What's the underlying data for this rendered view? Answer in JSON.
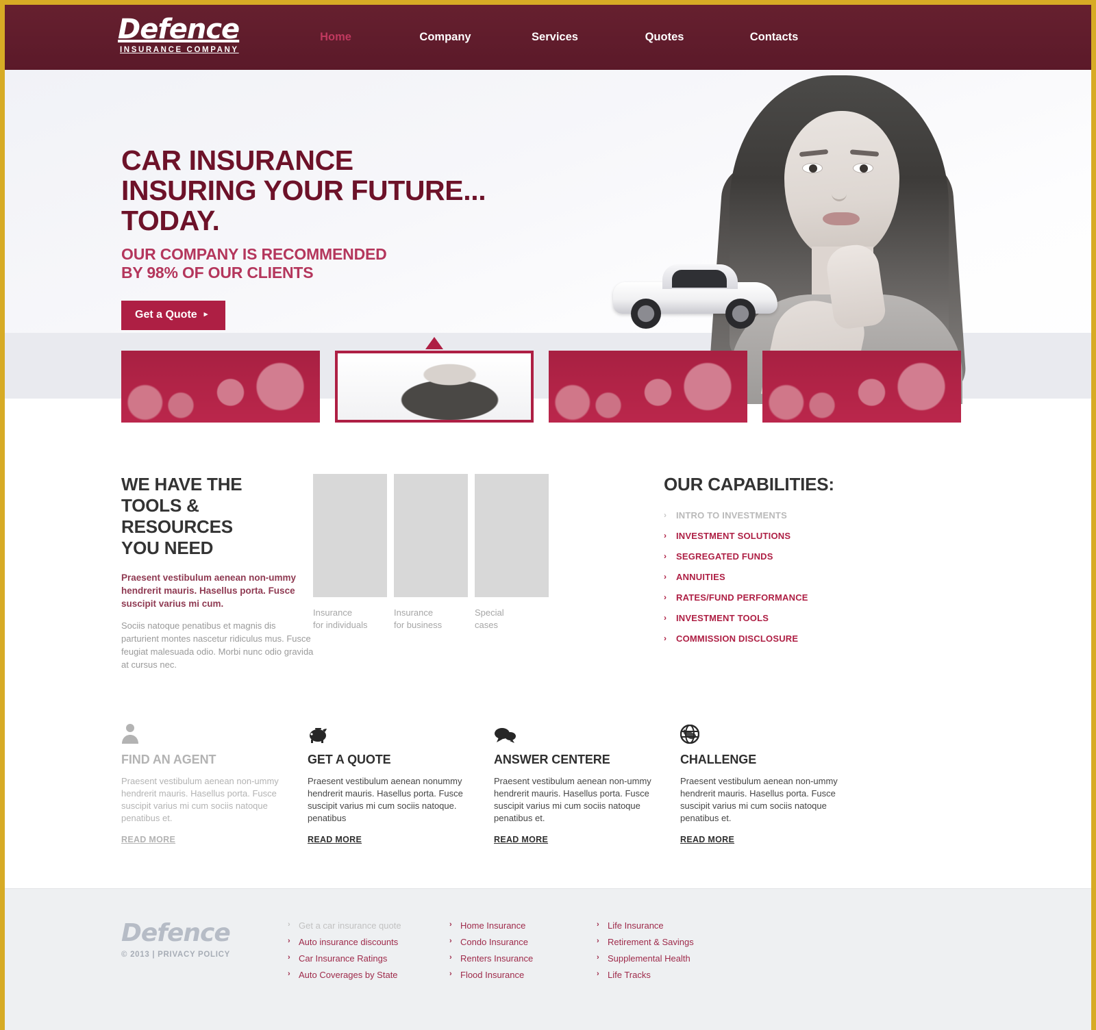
{
  "brand": {
    "name": "Defence",
    "tagline": "INSURANCE COMPANY"
  },
  "nav": {
    "items": [
      {
        "label": "Home",
        "active": true
      },
      {
        "label": "Company",
        "active": false
      },
      {
        "label": "Services",
        "active": false
      },
      {
        "label": "Quotes",
        "active": false
      },
      {
        "label": "Contacts",
        "active": false
      }
    ]
  },
  "hero": {
    "title_line1": "CAR INSURANCE",
    "title_line2": "INSURING YOUR FUTURE...",
    "title_line3": "TODAY.",
    "subtitle_line1": "OUR COMPANY IS RECOMMENDED",
    "subtitle_line2": "BY 98% OF OUR CLIENTS",
    "cta_label": "Get a Quote",
    "cta_arrow": "▸"
  },
  "slider": {
    "thumbs": [
      {
        "name": "thumb-1-family",
        "active": false
      },
      {
        "name": "thumb-2-woman-with-car",
        "active": true
      },
      {
        "name": "thumb-3-couple",
        "active": false
      },
      {
        "name": "thumb-4-business-group",
        "active": false
      }
    ]
  },
  "tools": {
    "title_line1": "WE HAVE THE",
    "title_line2": "TOOLS & RESOURCES",
    "title_line3": "YOU NEED",
    "lead": "Praesent vestibulum aenean non-ummy hendrerit mauris. Hasellus porta. Fusce suscipit varius mi cum.",
    "body": "Sociis natoque penatibus et magnis dis parturient montes nascetur ridiculus mus. Fusce feugiat malesuada odio. Morbi nunc odio gravida at cursus nec."
  },
  "mid_images": [
    {
      "caption_line1": "Insurance",
      "caption_line2": "for individuals",
      "name": "photo-insurance-for-individuals"
    },
    {
      "caption_line1": "Insurance",
      "caption_line2": "for business",
      "name": "photo-insurance-for-business"
    },
    {
      "caption_line1": "Special",
      "caption_line2": "cases",
      "name": "photo-special-cases"
    }
  ],
  "capabilities": {
    "title": "OUR CAPABILITIES:",
    "chevron": "›",
    "items": [
      {
        "label": "INTRO TO INVESTMENTS",
        "muted": true
      },
      {
        "label": "INVESTMENT SOLUTIONS",
        "muted": false
      },
      {
        "label": "SEGREGATED FUNDS",
        "muted": false
      },
      {
        "label": "ANNUITIES",
        "muted": false
      },
      {
        "label": "RATES/FUND PERFORMANCE",
        "muted": false
      },
      {
        "label": "INVESTMENT TOOLS",
        "muted": false
      },
      {
        "label": "COMMISSION DISCLOSURE",
        "muted": false
      }
    ]
  },
  "features": [
    {
      "icon": "person-icon",
      "title": "FIND AN AGENT",
      "text": "Praesent vestibulum aenean non-ummy hendrerit mauris. Hasellus porta. Fusce suscipit varius mi cum sociis natoque penatibus et.",
      "more": "READ MORE",
      "muted": true
    },
    {
      "icon": "piggy-bank-icon",
      "title": "GET A QUOTE",
      "text": "Praesent vestibulum aenean nonummy hendrerit mauris. Hasellus porta. Fusce suscipit varius mi cum sociis natoque. penatibus",
      "more": "READ MORE",
      "muted": false
    },
    {
      "icon": "speech-bubbles-icon",
      "title": "ANSWER CENTERE",
      "text": "Praesent vestibulum aenean non-ummy hendrerit mauris. Hasellus porta. Fusce suscipit varius mi cum sociis natoque penatibus et.",
      "more": "READ MORE",
      "muted": false
    },
    {
      "icon": "globe-icon",
      "title": "CHALLENGE",
      "text": "Praesent vestibulum aenean non-ummy hendrerit mauris. Hasellus porta. Fusce suscipit varius mi cum sociis natoque penatibus et.",
      "more": "READ MORE",
      "muted": false
    }
  ],
  "footer": {
    "logo": "Defence",
    "copyright": "© 2013 |",
    "privacy": "PRIVACY POLICY",
    "chevron": "›",
    "columns": [
      {
        "name": "footer-col-auto",
        "items": [
          {
            "label": "Get a car insurance quote",
            "muted": true
          },
          {
            "label": "Auto insurance discounts",
            "muted": false
          },
          {
            "label": "Car Insurance Ratings",
            "muted": false
          },
          {
            "label": "Auto Coverages by State",
            "muted": false
          }
        ]
      },
      {
        "name": "footer-col-property",
        "items": [
          {
            "label": "Home Insurance",
            "muted": false
          },
          {
            "label": "Condo Insurance",
            "muted": false
          },
          {
            "label": "Renters Insurance",
            "muted": false
          },
          {
            "label": "Flood Insurance",
            "muted": false
          }
        ]
      },
      {
        "name": "footer-col-life",
        "items": [
          {
            "label": "Life Insurance",
            "muted": false
          },
          {
            "label": "Retirement & Savings",
            "muted": false
          },
          {
            "label": "Supplemental Health",
            "muted": false
          },
          {
            "label": "Life Tracks",
            "muted": false
          }
        ]
      }
    ]
  },
  "colors": {
    "gold_frame": "#d7ab25",
    "header_maroon": "#5e1b2c",
    "accent_crimson": "#ae1f44",
    "active_nav": "#c0395f",
    "hero_title": "#6d1229",
    "hero_subtitle": "#b4365c",
    "footer_bg": "#eef0f2"
  }
}
